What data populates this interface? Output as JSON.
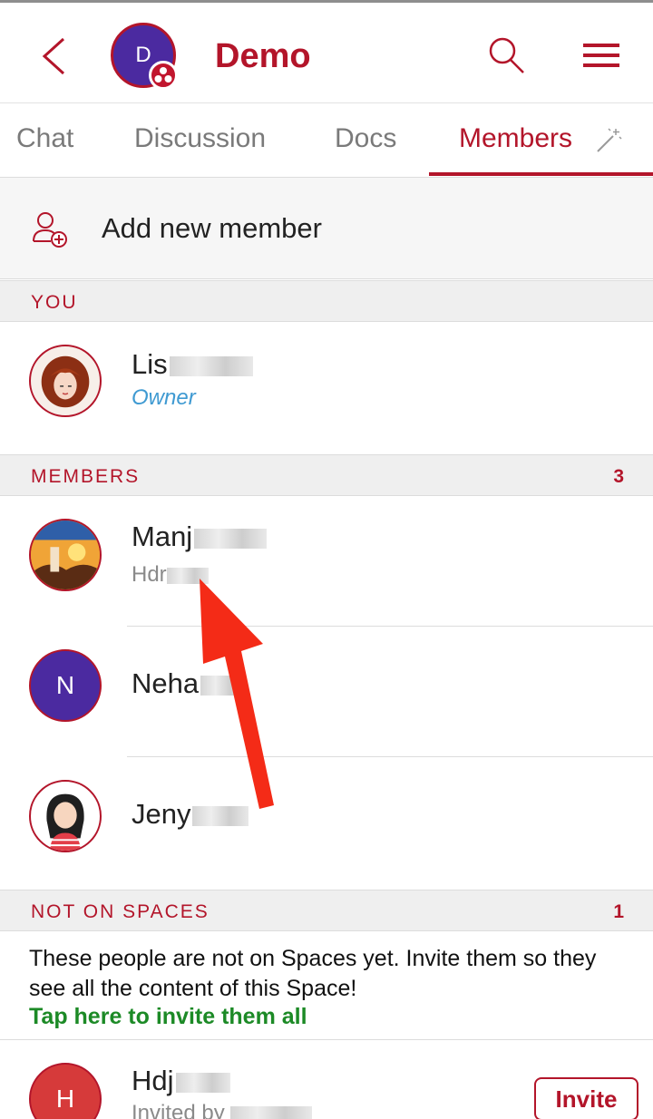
{
  "header": {
    "title": "Demo",
    "space_initial": "D",
    "accent": "#b3152a"
  },
  "tabs": [
    {
      "label": "Chat",
      "active": false
    },
    {
      "label": "Discussion",
      "active": false
    },
    {
      "label": "Docs",
      "active": false
    },
    {
      "label": "Members",
      "active": true
    }
  ],
  "add_member": {
    "label": "Add new member"
  },
  "you_section": {
    "title": "YOU",
    "member": {
      "name": "Lis",
      "role": "Owner"
    }
  },
  "members_section": {
    "title": "MEMBERS",
    "count": "3",
    "members": [
      {
        "name": "Manj",
        "subtitle": "Hdr"
      },
      {
        "name": "Neha",
        "initial": "N"
      },
      {
        "name": "Jeny"
      }
    ]
  },
  "not_on_spaces": {
    "title": "NOT ON SPACES",
    "count": "1",
    "notice": "These people are not on Spaces yet. Invite them so they see all the content of this Space!",
    "invite_all_link": "Tap here to invite them all",
    "people": [
      {
        "name": "Hdj",
        "initial": "H",
        "subtitle": "Invited by",
        "invite_label": "Invite"
      }
    ]
  },
  "icons": [
    "back-icon",
    "search-icon",
    "menu-icon",
    "magic-wand-icon",
    "add-member-icon",
    "group-badge-icon",
    "annotation-arrow"
  ]
}
